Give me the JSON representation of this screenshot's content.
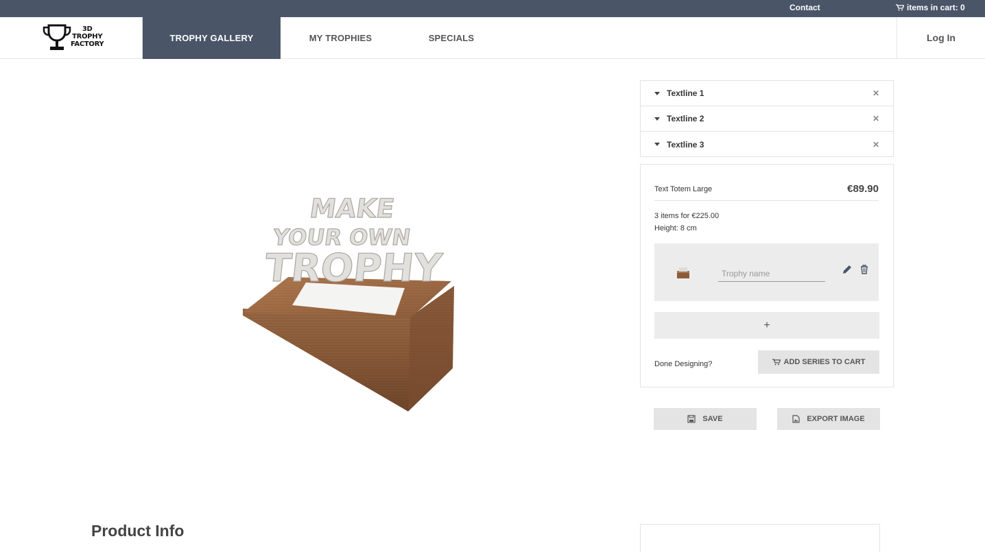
{
  "topbar": {
    "contact_label": "Contact",
    "cart_label": "items in cart: 0",
    "cart_icon": "cart-icon"
  },
  "brand": {
    "logo_line1": "3D",
    "logo_line2": "TROPHY",
    "logo_line3": "FACTORY",
    "logo_icon": "trophy-icon"
  },
  "nav": {
    "tabs": [
      {
        "label": "TROPHY GALLERY",
        "active": true
      },
      {
        "label": "MY TROPHIES",
        "active": false
      },
      {
        "label": "SPECIALS",
        "active": false
      }
    ],
    "login_label": "Log In"
  },
  "viewer": {
    "model_text_line1": "MAKE",
    "model_text_line2": "YOUR OWN",
    "model_text_line3": "TROPHY"
  },
  "textlines": {
    "items": [
      {
        "label": "Textline 1"
      },
      {
        "label": "Textline 2"
      },
      {
        "label": "Textline 3"
      }
    ]
  },
  "product": {
    "name": "Text Totem Large",
    "price": "€89.90",
    "bulk_offer": "3 items for €225.00",
    "height": "Height: 8 cm",
    "item_name_placeholder": "Trophy name",
    "add_label": "+",
    "done_label": "Done Designing?",
    "add_series_label": "ADD SERIES TO CART"
  },
  "actions": {
    "save_label": "SAVE",
    "export_label": "EXPORT IMAGE"
  },
  "footer": {
    "product_info_heading": "Product Info"
  },
  "colors": {
    "header_bg": "#4a5568",
    "active_tab_bg": "#4a5568",
    "button_bg": "#e4e4e4",
    "panel_bg": "#ececec"
  }
}
